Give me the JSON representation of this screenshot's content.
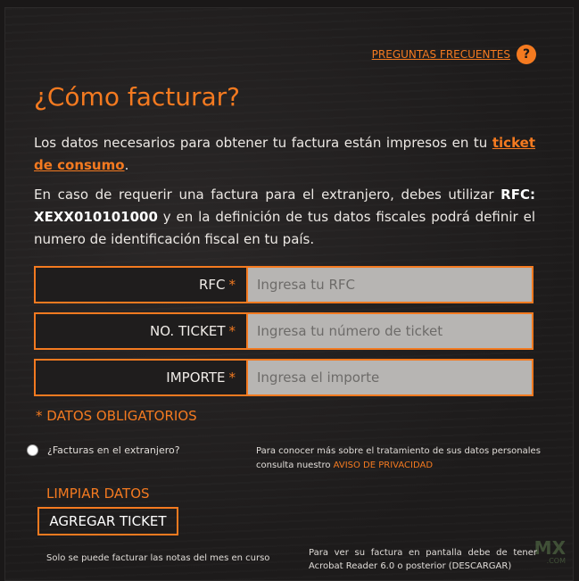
{
  "header": {
    "faq_label": "PREGUNTAS FRECUENTES",
    "faq_icon": "?",
    "title": "¿Cómo facturar?"
  },
  "intro": {
    "p1_text": "Los datos necesarios para obtener tu factura están impresos en tu",
    "p1_link": "ticket de consumo",
    "p1_end": ".",
    "p2_start": "En caso de requerir una factura para el extranjero, debes utilizar",
    "p2_rfc_label": "RFC:",
    "p2_rfc_value": "XEXX010101000",
    "p2_end": "y en la definición de tus datos fiscales podrá definir el numero de identificación fiscal en tu país."
  },
  "form": {
    "fields": [
      {
        "label": "RFC",
        "star": "*",
        "placeholder": "Ingresa tu RFC"
      },
      {
        "label": "NO. TICKET",
        "star": "*",
        "placeholder": "Ingresa tu número de ticket"
      },
      {
        "label": "IMPORTE",
        "star": "*",
        "placeholder": "Ingresa el importe"
      }
    ],
    "required_star": "*",
    "required_text": "DATOS OBLIGATORIOS",
    "foreign_label": "¿Facturas en el extranjero?",
    "privacy_text": "Para conocer más sobre el tratamiento de sus datos personales consulta nuestro",
    "privacy_link": "AVISO DE PRIVACIDAD",
    "clear_label": "LIMPIAR DATOS",
    "add_label": "AGREGAR TICKET",
    "note": "Solo se puede facturar las notas del mes en curso",
    "acrobat_text": "Para ver su factura en pantalla debe de tener Acrobat Reader 6.0 o posterior (DESCARGAR)"
  },
  "watermark": {
    "brand": "MX",
    "suffix": ".COM"
  },
  "colors": {
    "accent": "#f47a20",
    "background": "#1a1818",
    "input_bg": "#b7b5b3"
  }
}
